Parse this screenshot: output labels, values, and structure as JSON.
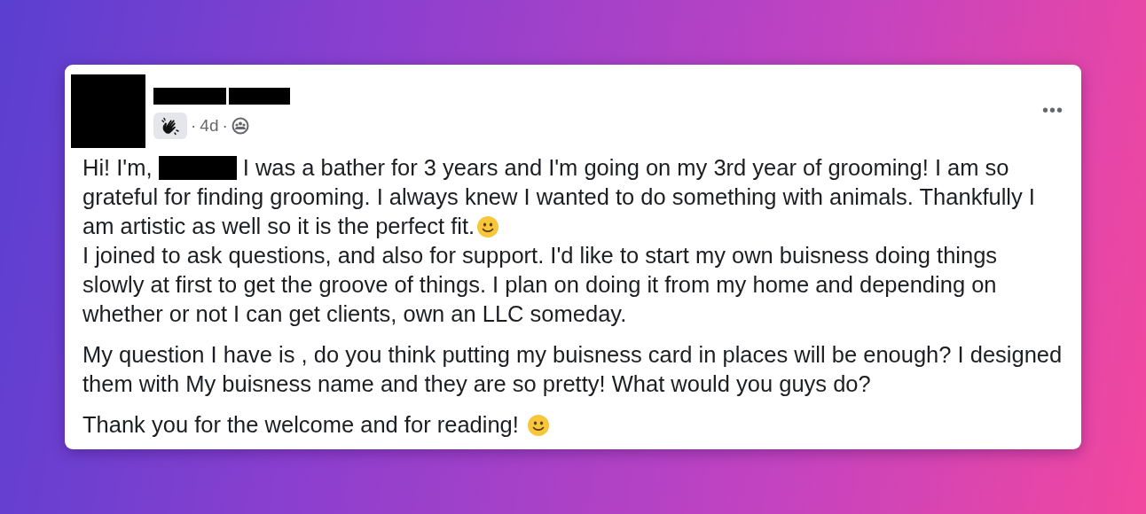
{
  "post": {
    "author": {
      "redacted": true
    },
    "badge": {
      "kind": "wave"
    },
    "meta": [
      "·",
      "4d",
      "·"
    ],
    "audience": {
      "kind": "group"
    },
    "more": "•••",
    "body": [
      [
        [
          {
            "kind": "text",
            "text": "Hi! I'm, "
          },
          {
            "kind": "redaction"
          },
          {
            "kind": "text",
            "text": " I was a bather for 3 years and I'm going on my 3rd year of grooming! I am so"
          }
        ],
        [
          {
            "kind": "text",
            "text": "grateful for finding grooming. I always knew I wanted to do something with animals. Thankfully I"
          }
        ],
        [
          {
            "kind": "text",
            "text": "am artistic as well so it is the perfect fit."
          },
          {
            "kind": "emoji"
          }
        ],
        [
          {
            "kind": "text",
            "text": "I joined to ask questions, and also for support. I'd like to start my own buisness doing things"
          }
        ],
        [
          {
            "kind": "text",
            "text": "slowly at first to get the groove of things. I plan on doing it from my home and depending on"
          }
        ],
        [
          {
            "kind": "text",
            "text": "whether or not I can get clients, own an LLC someday."
          }
        ]
      ],
      [
        [
          {
            "kind": "text",
            "text": "My question I have is , do you think putting my buisness card in places will be enough? I designed"
          }
        ],
        [
          {
            "kind": "text",
            "text": "them with My buisness name and they are so pretty! What would you guys do?"
          }
        ]
      ],
      [
        [
          {
            "kind": "text",
            "text": "Thank you for the welcome and for reading! "
          },
          {
            "kind": "emoji"
          }
        ]
      ]
    ]
  }
}
